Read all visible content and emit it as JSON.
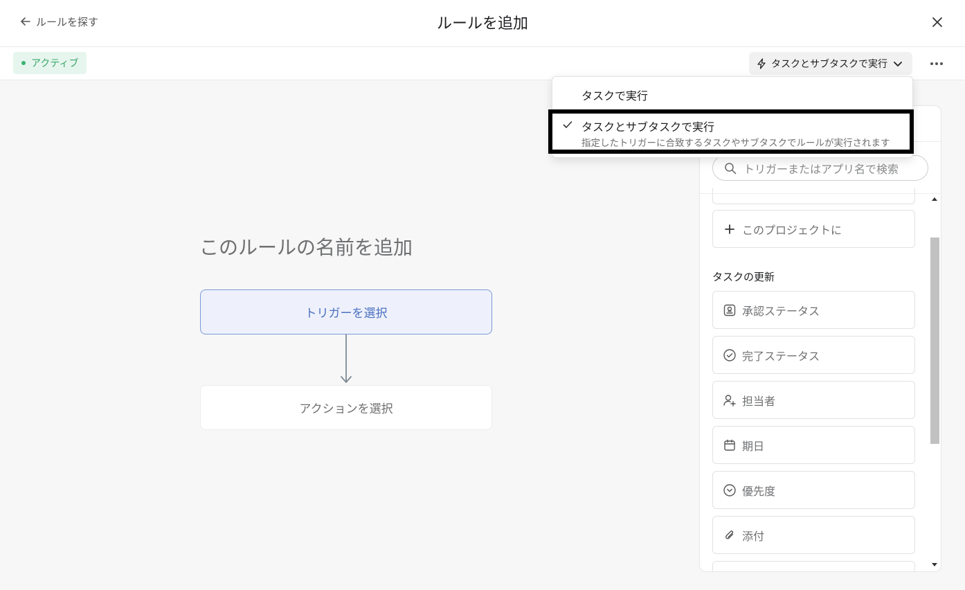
{
  "header": {
    "back_label": "ルールを探す",
    "title": "ルールを追加"
  },
  "toolbar": {
    "status": "アクティブ",
    "run_mode": "タスクとサブタスクで実行"
  },
  "dropdown": {
    "options": [
      {
        "label": "タスクで実行",
        "selected": false
      },
      {
        "label": "タスクとサブタスクで実行",
        "selected": true,
        "description": "指定したトリガーに合致するタスクやサブタスクでルールが実行されます"
      }
    ]
  },
  "canvas": {
    "rule_name_placeholder": "このルールの名前を追加",
    "trigger_label": "トリガーを選択",
    "action_label": "アクションを選択"
  },
  "panel": {
    "search_placeholder": "トリガーまたはアプリ名で検索",
    "add_to_project": "このプロジェクトに",
    "section_title": "タスクの更新",
    "items": [
      {
        "label": "承認ステータス",
        "icon": "approval-icon"
      },
      {
        "label": "完了ステータス",
        "icon": "check-circle-icon"
      },
      {
        "label": "担当者",
        "icon": "assignee-icon"
      },
      {
        "label": "期日",
        "icon": "calendar-icon"
      },
      {
        "label": "優先度",
        "icon": "chevron-circle-icon"
      },
      {
        "label": "添付",
        "icon": "paperclip-icon"
      }
    ]
  },
  "colors": {
    "accent": "#4a6fc1",
    "active_green": "#3aa66a"
  }
}
